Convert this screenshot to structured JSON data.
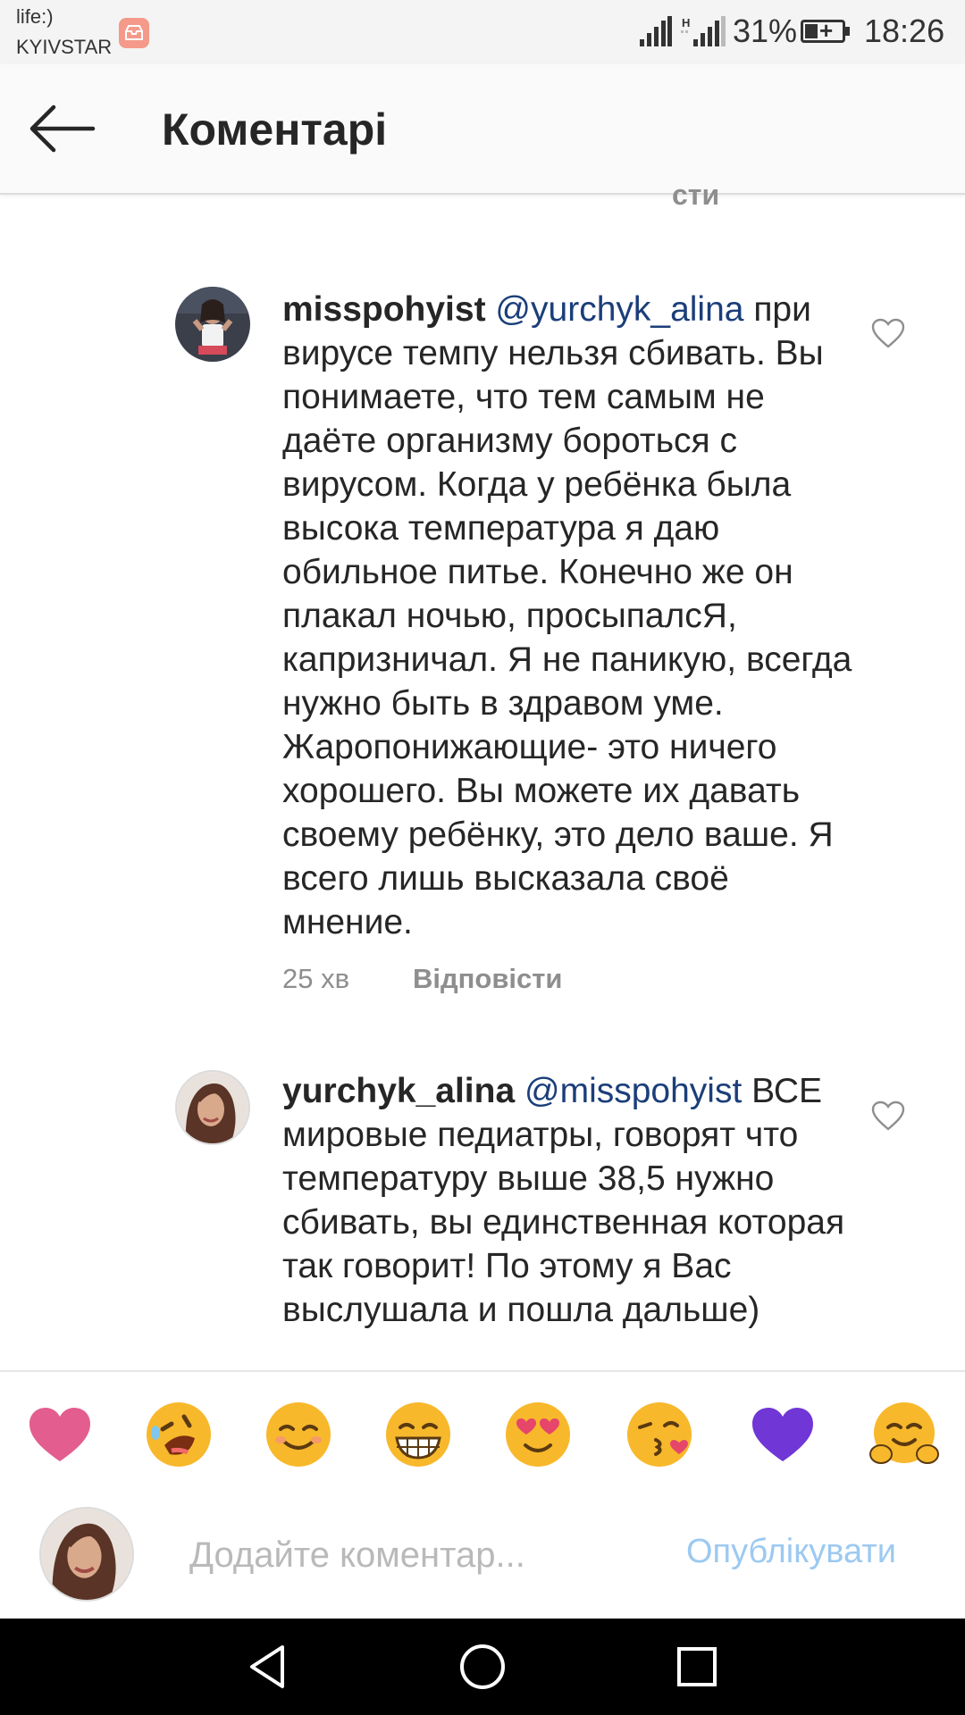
{
  "status_bar": {
    "carrier_line1": "life:)",
    "carrier_line2": "KYIVSTAR",
    "network_type": "H",
    "battery": "31%",
    "time": "18:26",
    "icons": [
      "notification-badge-icon",
      "signal-icon",
      "signal-h-icon",
      "battery-charging-icon"
    ]
  },
  "header": {
    "title": "Коментарі",
    "back_icon": "arrow-left-icon"
  },
  "clipped_fragment": "сти",
  "comments": [
    {
      "username": "misspohyist",
      "mention": "@yurchyk_alina",
      "text": "при вирусе темпу нельзя сбивать. Вы понимаете, что тем самым не даёте организму бороться с вирусом. Когда у ребёнка была высока температура я даю обильное питье. Конечно же он плакал ночью, просыпалсЯ, капризничал. Я не паникую, всегда нужно быть в здравом уме. Жаропонижающие- это ничего хорошего. Вы можете их давать своему ребёнку, это дело ваше. Я всего лишь высказала своё мнение.",
      "time": "25 хв",
      "reply_label": "Відповісти",
      "like_icon": "heart-outline-icon"
    },
    {
      "username": "yurchyk_alina",
      "mention": "@misspohyist",
      "text": "ВСЕ мировые педиатры, говорят что температуру выше 38,5 нужно сбивать, вы единственная которая так говорит! По этому я Вас выслушала и пошла дальше)",
      "like_icon": "heart-outline-icon"
    }
  ],
  "emoji_bar": [
    "pink-heart-icon",
    "rolling-laughing-face-icon",
    "smiling-face-icon",
    "grinning-face-icon",
    "heart-eyes-face-icon",
    "kissing-face-icon",
    "purple-heart-icon",
    "hugging-face-icon"
  ],
  "composer": {
    "placeholder": "Додайте коментар...",
    "value": "",
    "publish_label": "Опублікувати"
  },
  "nav_bar": [
    "back-triangle-icon",
    "home-circle-icon",
    "recents-square-icon"
  ],
  "colors": {
    "mention": "#1b3e7a",
    "publish": "#9cc9f1",
    "meta": "#8e8e8e",
    "purple_heart": "#7036d6",
    "pink_heart": "#e35d8f",
    "emoji_yellow": "#f8b82c"
  }
}
